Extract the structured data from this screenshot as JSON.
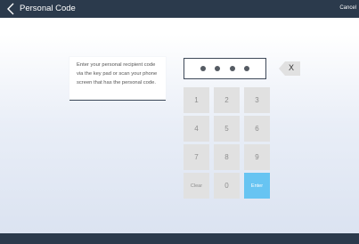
{
  "header": {
    "title": "Personal Code",
    "cancel_label": "Cancel"
  },
  "instruction": {
    "lines": [
      "Enter your personal recipient code",
      "via the key pad or scan your phone",
      "screen that has the personal code."
    ]
  },
  "code_entry": {
    "digits_entered": 4,
    "backspace_label": "X"
  },
  "keypad": {
    "k1": "1",
    "k2": "2",
    "k3": "3",
    "k4": "4",
    "k5": "5",
    "k6": "6",
    "k7": "7",
    "k8": "8",
    "k9": "9",
    "clear": "Clear",
    "k0": "0",
    "enter": "Enter"
  },
  "colors": {
    "bar": "#2b3a4c",
    "key": "#e1e1e1",
    "enter": "#67c4f2"
  },
  "icons": {
    "back": "chevron-left-icon",
    "backspace": "backspace-icon"
  }
}
